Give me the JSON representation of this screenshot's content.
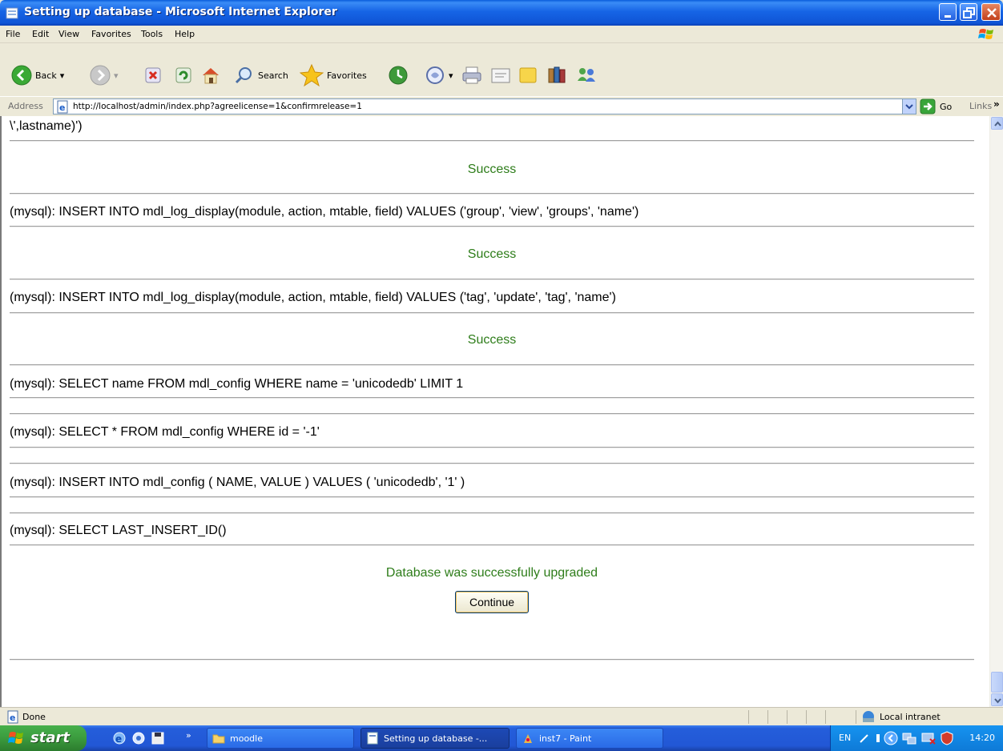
{
  "window": {
    "title": "Setting up database - Microsoft Internet Explorer"
  },
  "menu": {
    "items": [
      "File",
      "Edit",
      "View",
      "Favorites",
      "Tools",
      "Help"
    ]
  },
  "toolbar": {
    "back_label": "Back",
    "search_label": "Search",
    "favorites_label": "Favorites"
  },
  "address": {
    "label": "Address",
    "url": "http://localhost/admin/index.php?agreelicense=1&confirmrelease=1",
    "go_label": "Go",
    "links_label": "Links"
  },
  "content": {
    "top_fragment": "\\',lastname)')",
    "success_1": "Success",
    "sql_1": "(mysql): INSERT INTO mdl_log_display(module, action, mtable, field) VALUES ('group', 'view', 'groups', 'name')",
    "success_2": "Success",
    "sql_2": "(mysql): INSERT INTO mdl_log_display(module, action, mtable, field) VALUES ('tag', 'update', 'tag', 'name')",
    "success_3": "Success",
    "sql_3": "(mysql): SELECT name FROM mdl_config WHERE name = 'unicodedb' LIMIT 1",
    "sql_4": "(mysql): SELECT * FROM mdl_config WHERE id = '-1'",
    "sql_5": "(mysql): INSERT INTO mdl_config ( NAME, VALUE ) VALUES ( 'unicodedb', '1' )",
    "sql_6": "(mysql): SELECT LAST_INSERT_ID()",
    "final_message": "Database was successfully upgraded",
    "continue_label": "Continue"
  },
  "statusbar": {
    "status": "Done",
    "zone": "Local intranet"
  },
  "taskbar": {
    "start_label": "start",
    "tasks": [
      "moodle",
      "Setting up database -...",
      "inst7 - Paint"
    ],
    "language": "EN",
    "clock": "14:20"
  },
  "colors": {
    "success_green": "#2e7d1a",
    "titlebar_blue": "#0f55d6",
    "start_green": "#3b9b3e"
  }
}
